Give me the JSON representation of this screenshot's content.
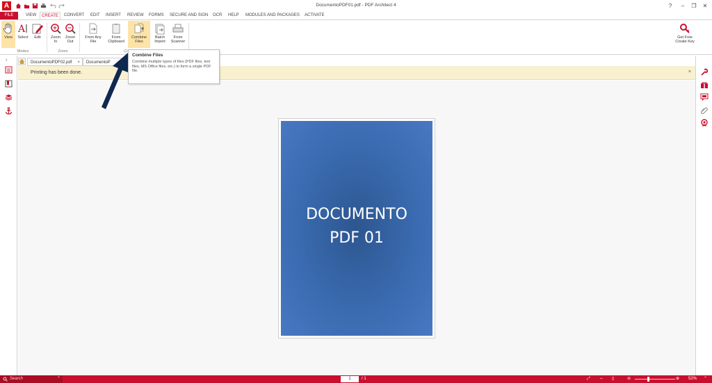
{
  "window": {
    "title": "DocumentoPDF01.pdf  -  PDF Architect 4",
    "logo_letter": "A",
    "controls": {
      "help": "?",
      "minimize": "–",
      "restore": "❐",
      "close": "✕"
    }
  },
  "menu": {
    "file": "FILE",
    "tabs": [
      "VIEW",
      "CREATE",
      "CONVERT",
      "EDIT",
      "INSERT",
      "REVIEW",
      "FORMS",
      "SECURE AND SIGN",
      "OCR",
      "HELP",
      "MODULES AND PACKAGES",
      "ACTIVATE"
    ],
    "active_tab": "CREATE"
  },
  "ribbon": {
    "view": "View",
    "select": "Select",
    "edit": "Edit",
    "zoom_in": "Zoom\nIn",
    "zoom_out": "Zoom\nOut",
    "from_any_file": "From Any\nFile",
    "from_clipboard": "From\nClipboard",
    "combine_files": "Combine\nFiles",
    "batch_import": "Batch\nImport",
    "from_scanner": "From\nScanner",
    "get_free_key": "Get Free\nCreate Key",
    "groups": {
      "modes": "Modes",
      "zoom": "Zoom",
      "create": "Cr"
    }
  },
  "doc_tabs": [
    {
      "label": "DocumentoPDF02.pdf",
      "close": "×"
    },
    {
      "label": "DocumentoP",
      "close": ""
    }
  ],
  "notification": {
    "text": "Printing has been done.",
    "close": "×"
  },
  "tooltip": {
    "title": "Combine Files",
    "body": "Combine multiple types of files (PDF files, text files, MS Office files, etc.) to form a single PDF file."
  },
  "document": {
    "cover_line1": "DOCUMENTO",
    "cover_line2": "PDF 01"
  },
  "statusbar": {
    "search_placeholder": "Search",
    "page_current": "1",
    "page_total": "/ 1",
    "zoom": "52%"
  },
  "colors": {
    "brand": "#c8102e",
    "ribbon_active": "#fde3a7",
    "notification": "#f8f0cf",
    "cover": "#3a6bb0"
  },
  "icons": {
    "left_panel": [
      "thumbnails-icon",
      "bookmarks-icon",
      "layers-icon",
      "anchor-icon"
    ],
    "right_panel": [
      "tools-icon",
      "gift-icon",
      "comment-icon",
      "attachment-icon",
      "certificate-icon"
    ]
  }
}
